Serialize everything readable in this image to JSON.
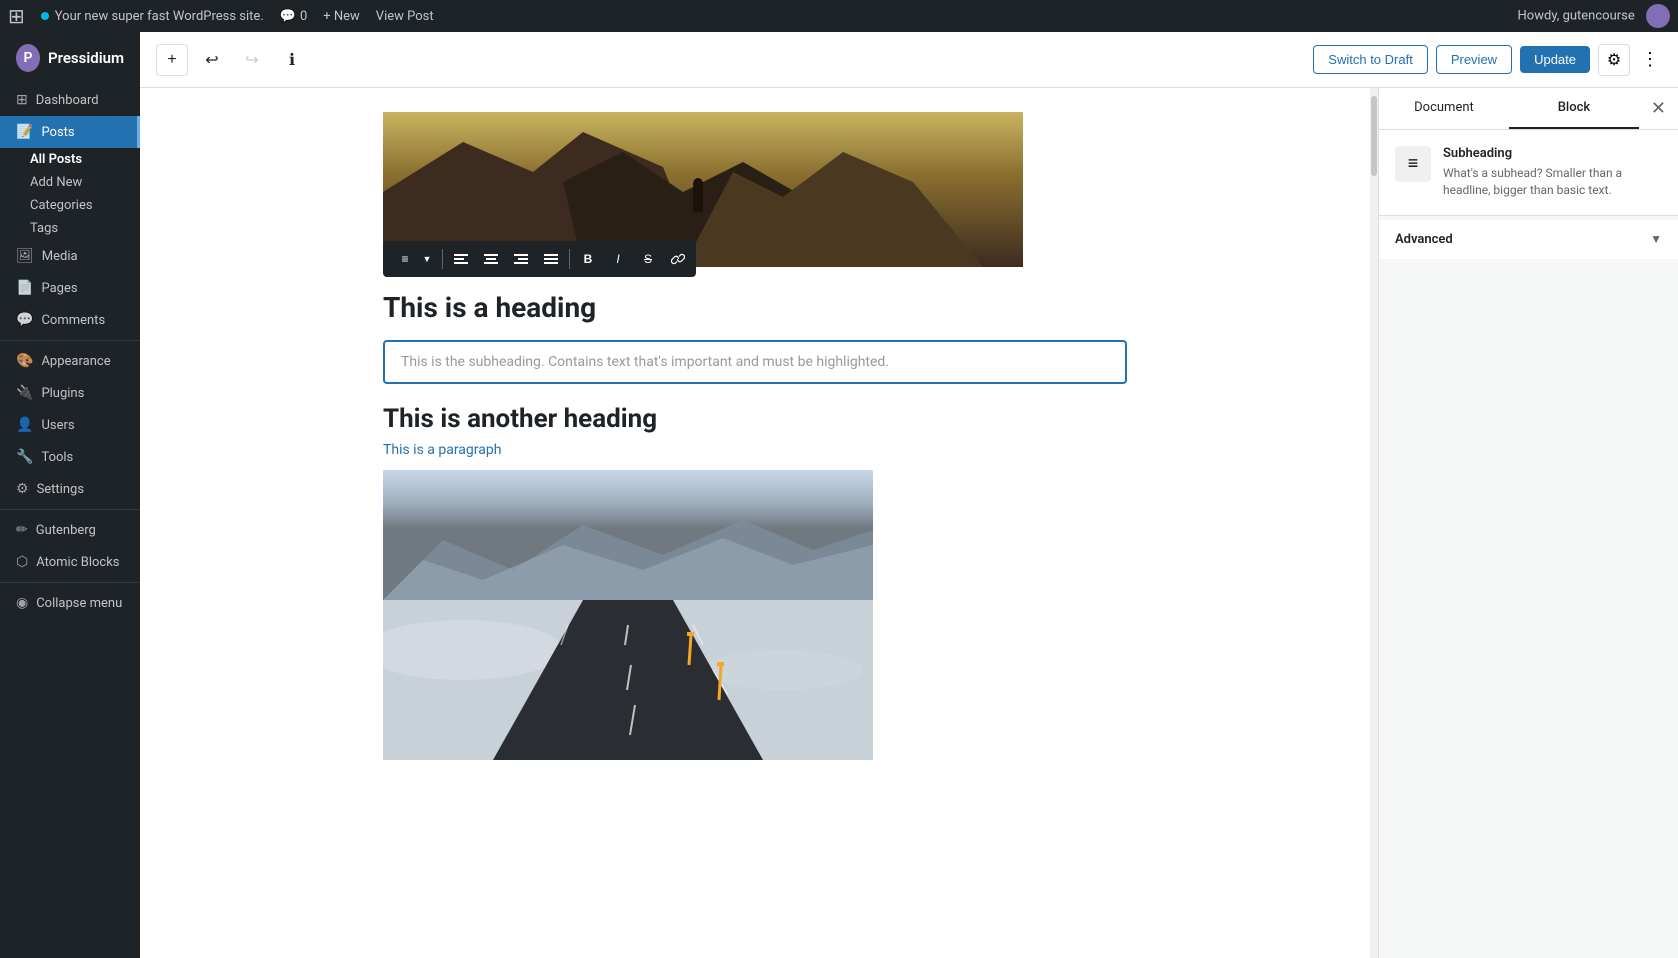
{
  "admin_bar": {
    "logo": "⊞",
    "site_name": "Your new super fast WordPress site.",
    "comments_label": "💬",
    "comments_count": "0",
    "new_label": "+ New",
    "view_post_label": "View Post",
    "howdy": "Howdy, gutencourse"
  },
  "sidebar": {
    "brand": "Pressidium",
    "items": [
      {
        "id": "dashboard",
        "label": "Dashboard",
        "icon": "⊞"
      },
      {
        "id": "posts",
        "label": "Posts",
        "icon": "📝",
        "active": true
      },
      {
        "id": "all-posts",
        "label": "All Posts",
        "submenu": true,
        "bold": true
      },
      {
        "id": "add-new",
        "label": "Add New",
        "submenu": true
      },
      {
        "id": "categories",
        "label": "Categories",
        "submenu": true
      },
      {
        "id": "tags",
        "label": "Tags",
        "submenu": true
      },
      {
        "id": "media",
        "label": "Media",
        "icon": "🖼"
      },
      {
        "id": "pages",
        "label": "Pages",
        "icon": "📄"
      },
      {
        "id": "comments",
        "label": "Comments",
        "icon": "💬"
      },
      {
        "id": "appearance",
        "label": "Appearance",
        "icon": "🎨"
      },
      {
        "id": "plugins",
        "label": "Plugins",
        "icon": "🔌"
      },
      {
        "id": "users",
        "label": "Users",
        "icon": "👤"
      },
      {
        "id": "tools",
        "label": "Tools",
        "icon": "🔧"
      },
      {
        "id": "settings",
        "label": "Settings",
        "icon": "⚙"
      },
      {
        "id": "gutenberg",
        "label": "Gutenberg",
        "icon": "✏"
      },
      {
        "id": "atomic-blocks",
        "label": "Atomic Blocks",
        "icon": "⬡"
      },
      {
        "id": "collapse-menu",
        "label": "Collapse menu",
        "icon": "◉"
      }
    ]
  },
  "editor": {
    "toolbar": {
      "add_block_label": "+",
      "undo_label": "↩",
      "redo_label": "↪",
      "info_label": "ℹ"
    },
    "buttons": {
      "switch_draft": "Switch to Draft",
      "preview": "Preview",
      "update": "Update"
    },
    "content": {
      "heading1": "This is a heading",
      "subheading_placeholder": "This is the subheading. Contains text that's important and must be highlighted.",
      "heading2": "This is another heading",
      "paragraph": "This is a paragraph"
    },
    "formatting_toolbar": {
      "align_left": "≡",
      "align_center": "≡",
      "align_right": "≡",
      "align_justify": "≡",
      "bold": "B",
      "italic": "I",
      "strikethrough": "S̶",
      "link": "🔗"
    }
  },
  "right_panel": {
    "tab_document": "Document",
    "tab_block": "Block",
    "close_label": "✕",
    "block_info": {
      "icon": "≡",
      "title": "Subheading",
      "description": "What's a subhead? Smaller than a headline, bigger than basic text."
    },
    "sections": [
      {
        "id": "advanced",
        "label": "Advanced"
      }
    ]
  }
}
